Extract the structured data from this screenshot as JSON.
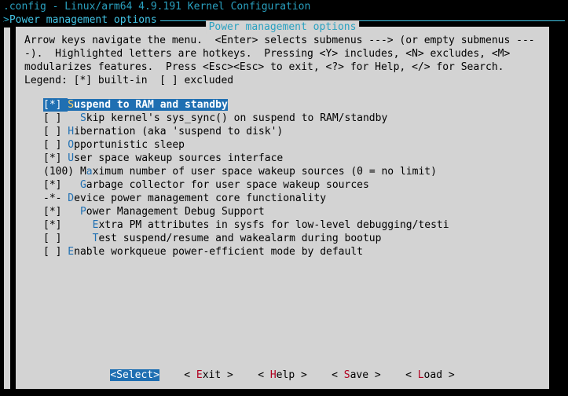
{
  "title": ".config - Linux/arm64 4.9.191 Kernel Configuration",
  "breadcrumb": "Power management options",
  "panel_title": "Power management options",
  "help_text": "Arrow keys navigate the menu.  <Enter> selects submenus ---> (or empty submenus ----).  Highlighted letters are hotkeys.  Pressing <Y> includes, <N> excludes, <M> modularizes features.  Press <Esc><Esc> to exit, <?> for Help, </> for Search.  Legend: [*] built-in  [ ] excluded",
  "items": [
    {
      "selected": true,
      "marker": "[*] ",
      "pref": "",
      "hot": "S",
      "label": "uspend to RAM and standby"
    },
    {
      "selected": false,
      "marker": "[ ] ",
      "pref": "  ",
      "hot": "S",
      "label": "kip kernel's sys_sync() on suspend to RAM/standby"
    },
    {
      "selected": false,
      "marker": "[ ] ",
      "pref": "",
      "hot": "H",
      "label": "ibernation (aka 'suspend to disk')"
    },
    {
      "selected": false,
      "marker": "[ ] ",
      "pref": "",
      "hot": "O",
      "label": "pportunistic sleep"
    },
    {
      "selected": false,
      "marker": "[*] ",
      "pref": "",
      "hot": "U",
      "label": "ser space wakeup sources interface"
    },
    {
      "selected": false,
      "marker": "(100)",
      "pref": " M",
      "hot": "a",
      "label": "ximum number of user space wakeup sources (0 = no limit)"
    },
    {
      "selected": false,
      "marker": "[*] ",
      "pref": "  ",
      "hot": "G",
      "label": "arbage collector for user space wakeup sources"
    },
    {
      "selected": false,
      "marker": "-*- ",
      "pref": "",
      "hot": "D",
      "label": "evice power management core functionality"
    },
    {
      "selected": false,
      "marker": "[*] ",
      "pref": "  ",
      "hot": "P",
      "label": "ower Management Debug Support"
    },
    {
      "selected": false,
      "marker": "[*] ",
      "pref": "    ",
      "hot": "E",
      "label": "xtra PM attributes in sysfs for low-level debugging/testi"
    },
    {
      "selected": false,
      "marker": "[ ] ",
      "pref": "    ",
      "hot": "T",
      "label": "est suspend/resume and wakealarm during bootup"
    },
    {
      "selected": false,
      "marker": "[ ] ",
      "pref": "",
      "hot": "E",
      "label": "nable workqueue power-efficient mode by default"
    }
  ],
  "buttons": [
    {
      "active": true,
      "open": "<",
      "hot": "S",
      "rest": "elect",
      "close": ">"
    },
    {
      "active": false,
      "open": "< ",
      "hot": "E",
      "rest": "xit ",
      "close": ">"
    },
    {
      "active": false,
      "open": "< ",
      "hot": "H",
      "rest": "elp ",
      "close": ">"
    },
    {
      "active": false,
      "open": "< ",
      "hot": "S",
      "rest": "ave ",
      "close": ">"
    },
    {
      "active": false,
      "open": "< ",
      "hot": "L",
      "rest": "oad ",
      "close": ">"
    }
  ],
  "button_gap": "    "
}
